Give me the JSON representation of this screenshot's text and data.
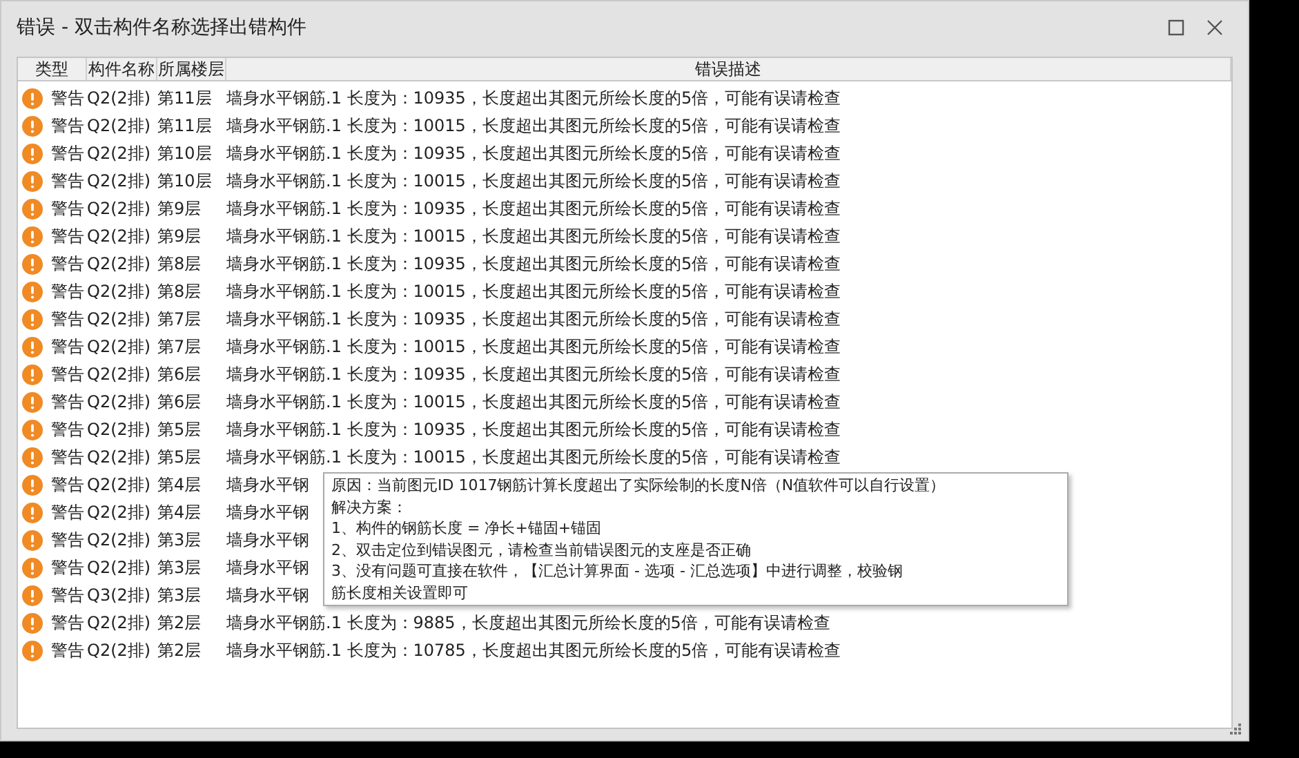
{
  "window": {
    "title": "错误 - 双击构件名称选择出错构件"
  },
  "table": {
    "columns": [
      "类型",
      "构件名称",
      "所属楼层",
      "错误描述"
    ],
    "rows": [
      {
        "kind": "warning",
        "type": "警告",
        "name": "Q2(2排)",
        "floor": "第11层",
        "description": "墙身水平钢筋.1 长度为：10935，长度超出其图元所绘长度的5倍，可能有误请检查"
      },
      {
        "kind": "warning",
        "type": "警告",
        "name": "Q2(2排)",
        "floor": "第11层",
        "description": "墙身水平钢筋.1 长度为：10015，长度超出其图元所绘长度的5倍，可能有误请检查"
      },
      {
        "kind": "warning",
        "type": "警告",
        "name": "Q2(2排)",
        "floor": "第10层",
        "description": "墙身水平钢筋.1 长度为：10935，长度超出其图元所绘长度的5倍，可能有误请检查"
      },
      {
        "kind": "warning",
        "type": "警告",
        "name": "Q2(2排)",
        "floor": "第10层",
        "description": "墙身水平钢筋.1 长度为：10015，长度超出其图元所绘长度的5倍，可能有误请检查"
      },
      {
        "kind": "warning",
        "type": "警告",
        "name": "Q2(2排)",
        "floor": "第9层",
        "description": "墙身水平钢筋.1 长度为：10935，长度超出其图元所绘长度的5倍，可能有误请检查"
      },
      {
        "kind": "warning",
        "type": "警告",
        "name": "Q2(2排)",
        "floor": "第9层",
        "description": "墙身水平钢筋.1 长度为：10015，长度超出其图元所绘长度的5倍，可能有误请检查"
      },
      {
        "kind": "warning",
        "type": "警告",
        "name": "Q2(2排)",
        "floor": "第8层",
        "description": "墙身水平钢筋.1 长度为：10935，长度超出其图元所绘长度的5倍，可能有误请检查"
      },
      {
        "kind": "warning",
        "type": "警告",
        "name": "Q2(2排)",
        "floor": "第8层",
        "description": "墙身水平钢筋.1 长度为：10015，长度超出其图元所绘长度的5倍，可能有误请检查"
      },
      {
        "kind": "warning",
        "type": "警告",
        "name": "Q2(2排)",
        "floor": "第7层",
        "description": "墙身水平钢筋.1 长度为：10935，长度超出其图元所绘长度的5倍，可能有误请检查"
      },
      {
        "kind": "warning",
        "type": "警告",
        "name": "Q2(2排)",
        "floor": "第7层",
        "description": "墙身水平钢筋.1 长度为：10015，长度超出其图元所绘长度的5倍，可能有误请检查"
      },
      {
        "kind": "warning",
        "type": "警告",
        "name": "Q2(2排)",
        "floor": "第6层",
        "description": "墙身水平钢筋.1 长度为：10935，长度超出其图元所绘长度的5倍，可能有误请检查"
      },
      {
        "kind": "warning",
        "type": "警告",
        "name": "Q2(2排)",
        "floor": "第6层",
        "description": "墙身水平钢筋.1 长度为：10015，长度超出其图元所绘长度的5倍，可能有误请检查"
      },
      {
        "kind": "warning",
        "type": "警告",
        "name": "Q2(2排)",
        "floor": "第5层",
        "description": "墙身水平钢筋.1 长度为：10935，长度超出其图元所绘长度的5倍，可能有误请检查"
      },
      {
        "kind": "warning",
        "type": "警告",
        "name": "Q2(2排)",
        "floor": "第5层",
        "description": "墙身水平钢筋.1 长度为：10015，长度超出其图元所绘长度的5倍，可能有误请检查"
      },
      {
        "kind": "warning",
        "type": "警告",
        "name": "Q2(2排)",
        "floor": "第4层",
        "description": "墙身水平钢"
      },
      {
        "kind": "warning",
        "type": "警告",
        "name": "Q2(2排)",
        "floor": "第4层",
        "description": "墙身水平钢"
      },
      {
        "kind": "warning",
        "type": "警告",
        "name": "Q2(2排)",
        "floor": "第3层",
        "description": "墙身水平钢"
      },
      {
        "kind": "warning",
        "type": "警告",
        "name": "Q2(2排)",
        "floor": "第3层",
        "description": "墙身水平钢"
      },
      {
        "kind": "warning",
        "type": "警告",
        "name": "Q3(2排)",
        "floor": "第3层",
        "description": "墙身水平钢"
      },
      {
        "kind": "warning",
        "type": "警告",
        "name": "Q2(2排)",
        "floor": "第2层",
        "description": "墙身水平钢筋.1 长度为：9885，长度超出其图元所绘长度的5倍，可能有误请检查"
      },
      {
        "kind": "warning",
        "type": "警告",
        "name": "Q2(2排)",
        "floor": "第2层",
        "description": "墙身水平钢筋.1 长度为：10785，长度超出其图元所绘长度的5倍，可能有误请检查"
      }
    ]
  },
  "tooltip": {
    "lines": [
      "原因：当前图元ID 1017钢筋计算长度超出了实际绘制的长度N倍（N值软件可以自行设置）",
      "解决方案：",
      "1、构件的钢筋长度 = 净长+锚固+锚固",
      "2、双击定位到错误图元，请检查当前错误图元的支座是否正确",
      "3、没有问题可直接在软件，【汇总计算界面 - 选项 - 汇总选项】中进行调整，校验钢",
      "筋长度相关设置即可"
    ]
  }
}
